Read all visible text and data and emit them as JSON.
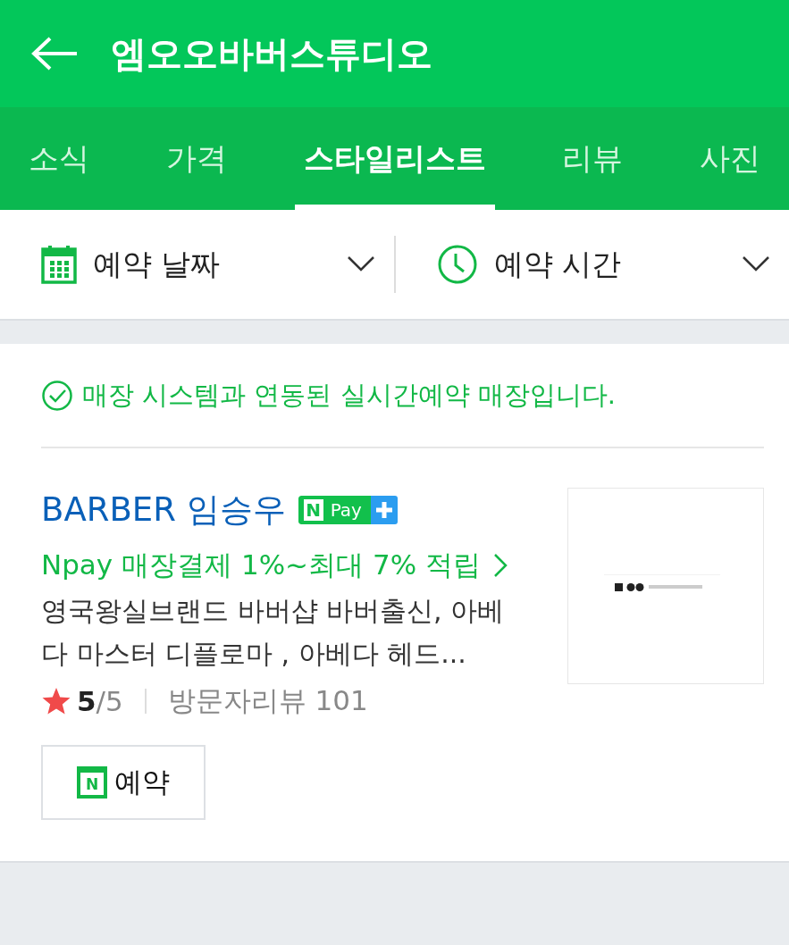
{
  "header": {
    "title": "엠오오바버스튜디오"
  },
  "tabs": [
    {
      "label": "소식",
      "selected": false
    },
    {
      "label": "가격",
      "selected": false
    },
    {
      "label": "스타일리스트",
      "selected": true
    },
    {
      "label": "리뷰",
      "selected": false
    },
    {
      "label": "사진",
      "selected": false
    }
  ],
  "filters": [
    {
      "kind": "date",
      "label": "예약 날짜"
    },
    {
      "kind": "time",
      "label": "예약 시간"
    }
  ],
  "notice": "매장 시스템과 연동된 실시간예약 매장입니다.",
  "stylist": {
    "name": "BARBER 임승우",
    "badge": {
      "letter": "N",
      "text": "Pay"
    },
    "promo": "Npay 매장결제 1%~최대 7% 적립",
    "description": "영국왕실브랜드 바버샵 바버출신, 아베다 마스터 디플로마 , 아베다 헤드...",
    "score": "5",
    "score_total": "/5",
    "reviews": "방문자리뷰 101",
    "button": {
      "icon_letter": "N",
      "label": "예약"
    }
  }
}
